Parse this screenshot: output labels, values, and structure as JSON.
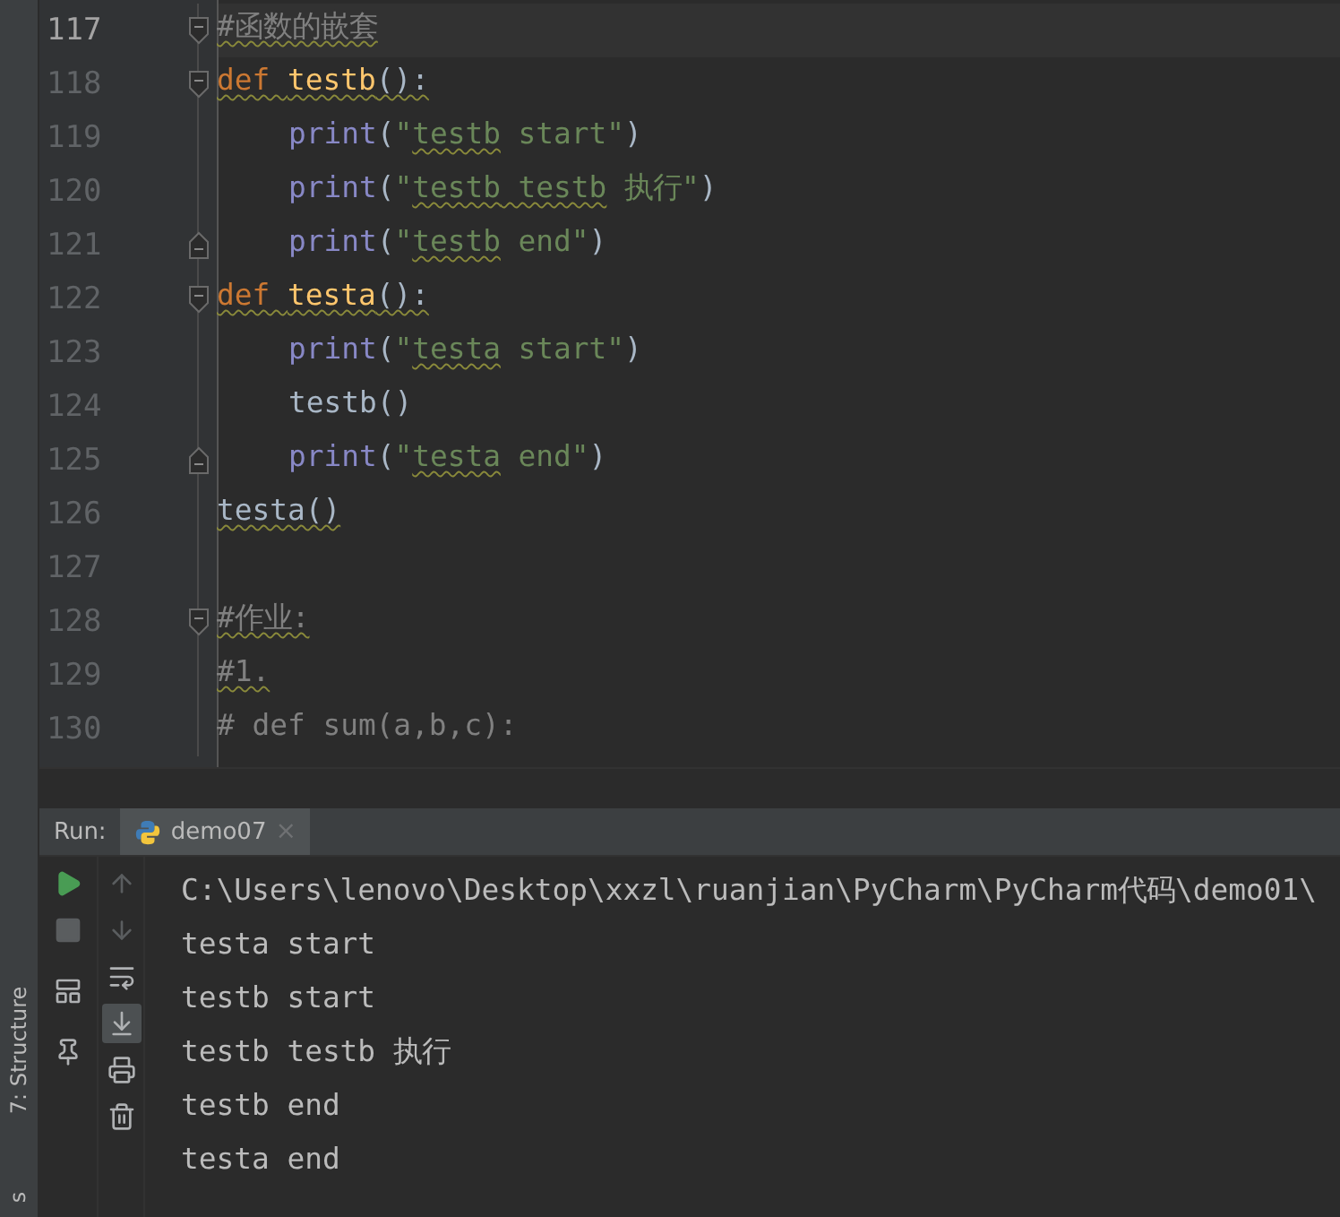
{
  "tool_strip": {
    "labels": [
      "7: Structure",
      "s"
    ]
  },
  "editor": {
    "lines": [
      {
        "number": "117",
        "current": true,
        "fold_start": true,
        "fold_end": false,
        "tokens": [
          {
            "text": "#函数的嵌套",
            "kind": "comment",
            "typo": true
          }
        ]
      },
      {
        "number": "118",
        "current": false,
        "fold_start": true,
        "fold_end": false,
        "tokens": [
          {
            "text": "def ",
            "kind": "keyword",
            "typo": true
          },
          {
            "text": "testb",
            "kind": "func",
            "typo": true
          },
          {
            "text": "():",
            "kind": "plain",
            "typo": true
          }
        ],
        "children": [
          {
            "number": "119",
            "current": false,
            "fold_start": false,
            "fold_end": false,
            "tokens": [
              {
                "text": "print",
                "kind": "builtin",
                "typo": false
              },
              {
                "text": "(",
                "kind": "plain",
                "typo": false
              },
              {
                "text": "\"",
                "kind": "string",
                "typo": false
              },
              {
                "text": "testb",
                "kind": "string",
                "typo": true
              },
              {
                "text": " start\"",
                "kind": "string",
                "typo": false
              },
              {
                "text": ")",
                "kind": "plain",
                "typo": false
              }
            ]
          },
          {
            "number": "120",
            "current": false,
            "fold_start": false,
            "fold_end": false,
            "tokens": [
              {
                "text": "print",
                "kind": "builtin",
                "typo": false
              },
              {
                "text": "(",
                "kind": "plain",
                "typo": false
              },
              {
                "text": "\"",
                "kind": "string",
                "typo": false
              },
              {
                "text": "testb",
                "kind": "string",
                "typo": true
              },
              {
                "text": " testb",
                "kind": "string",
                "typo": true
              },
              {
                "text": " 执行\"",
                "kind": "string",
                "typo": false
              },
              {
                "text": ")",
                "kind": "plain",
                "typo": false
              }
            ]
          },
          {
            "number": "121",
            "current": false,
            "fold_start": false,
            "fold_end": true,
            "tokens": [
              {
                "text": "print",
                "kind": "builtin",
                "typo": false
              },
              {
                "text": "(",
                "kind": "plain",
                "typo": false
              },
              {
                "text": "\"",
                "kind": "string",
                "typo": false
              },
              {
                "text": "testb",
                "kind": "string",
                "typo": true
              },
              {
                "text": " end\"",
                "kind": "string",
                "typo": false
              },
              {
                "text": ")",
                "kind": "plain",
                "typo": false
              }
            ]
          }
        ]
      },
      {
        "number": "122",
        "current": false,
        "fold_start": true,
        "fold_end": false,
        "tokens": [
          {
            "text": "def ",
            "kind": "keyword",
            "typo": true
          },
          {
            "text": "testa",
            "kind": "func",
            "typo": true
          },
          {
            "text": "():",
            "kind": "plain",
            "typo": true
          }
        ],
        "children": [
          {
            "number": "123",
            "current": false,
            "fold_start": false,
            "fold_end": false,
            "tokens": [
              {
                "text": "print",
                "kind": "builtin",
                "typo": false
              },
              {
                "text": "(",
                "kind": "plain",
                "typo": false
              },
              {
                "text": "\"",
                "kind": "string",
                "typo": false
              },
              {
                "text": "testa",
                "kind": "string",
                "typo": true
              },
              {
                "text": " start\"",
                "kind": "string",
                "typo": false
              },
              {
                "text": ")",
                "kind": "plain",
                "typo": false
              }
            ]
          },
          {
            "number": "124",
            "current": false,
            "fold_start": false,
            "fold_end": false,
            "tokens": [
              {
                "text": "testb()",
                "kind": "plain",
                "typo": false
              }
            ]
          },
          {
            "number": "125",
            "current": false,
            "fold_start": false,
            "fold_end": true,
            "tokens": [
              {
                "text": "print",
                "kind": "builtin",
                "typo": false
              },
              {
                "text": "(",
                "kind": "plain",
                "typo": false
              },
              {
                "text": "\"",
                "kind": "string",
                "typo": false
              },
              {
                "text": "testa",
                "kind": "string",
                "typo": true
              },
              {
                "text": " end\"",
                "kind": "string",
                "typo": false
              },
              {
                "text": ")",
                "kind": "plain",
                "typo": false
              }
            ]
          }
        ]
      },
      {
        "number": "126",
        "current": false,
        "fold_start": false,
        "fold_end": false,
        "tokens": [
          {
            "text": "testa()",
            "kind": "plain",
            "typo": true
          }
        ]
      },
      {
        "number": "127",
        "current": false,
        "fold_start": false,
        "fold_end": false
      },
      {
        "number": "128",
        "current": false,
        "fold_start": true,
        "fold_end": false,
        "tokens": [
          {
            "text": "#作业:",
            "kind": "comment",
            "typo": true
          }
        ]
      },
      {
        "number": "129",
        "current": false,
        "fold_start": false,
        "fold_end": false,
        "tokens": [
          {
            "text": "#1.",
            "kind": "comment",
            "typo": true
          }
        ]
      },
      {
        "number": "130",
        "current": false,
        "fold_start": false,
        "fold_end": false,
        "tokens": [
          {
            "text": "# def sum(a,b,c):",
            "kind": "comment",
            "typo": false
          }
        ]
      }
    ]
  },
  "run_panel": {
    "label": "Run:",
    "tabs": [
      {
        "title": "demo07",
        "close": "×",
        "selected": true
      }
    ],
    "left_tools": [
      {
        "kind": "run",
        "disabled": false
      },
      {
        "kind": "stop",
        "disabled": true
      },
      {
        "kind": "layout",
        "disabled": false
      },
      {
        "kind": "pin",
        "disabled": false
      }
    ],
    "side_tools": [
      {
        "kind": "up",
        "disabled": true,
        "selected": false
      },
      {
        "kind": "down",
        "disabled": true,
        "selected": false
      },
      {
        "kind": "wrap",
        "disabled": false,
        "selected": false
      },
      {
        "kind": "scroll-end",
        "disabled": false,
        "selected": true
      },
      {
        "kind": "print",
        "disabled": false,
        "selected": false
      },
      {
        "kind": "trash",
        "disabled": false,
        "selected": false
      }
    ],
    "output": [
      "C:\\Users\\lenovo\\Desktop\\xxzl\\ruanjian\\PyCharm\\PyCharm代码\\demo01\\",
      "testa start",
      "testb start",
      "testb testb 执行",
      "testb end",
      "testa end"
    ]
  }
}
